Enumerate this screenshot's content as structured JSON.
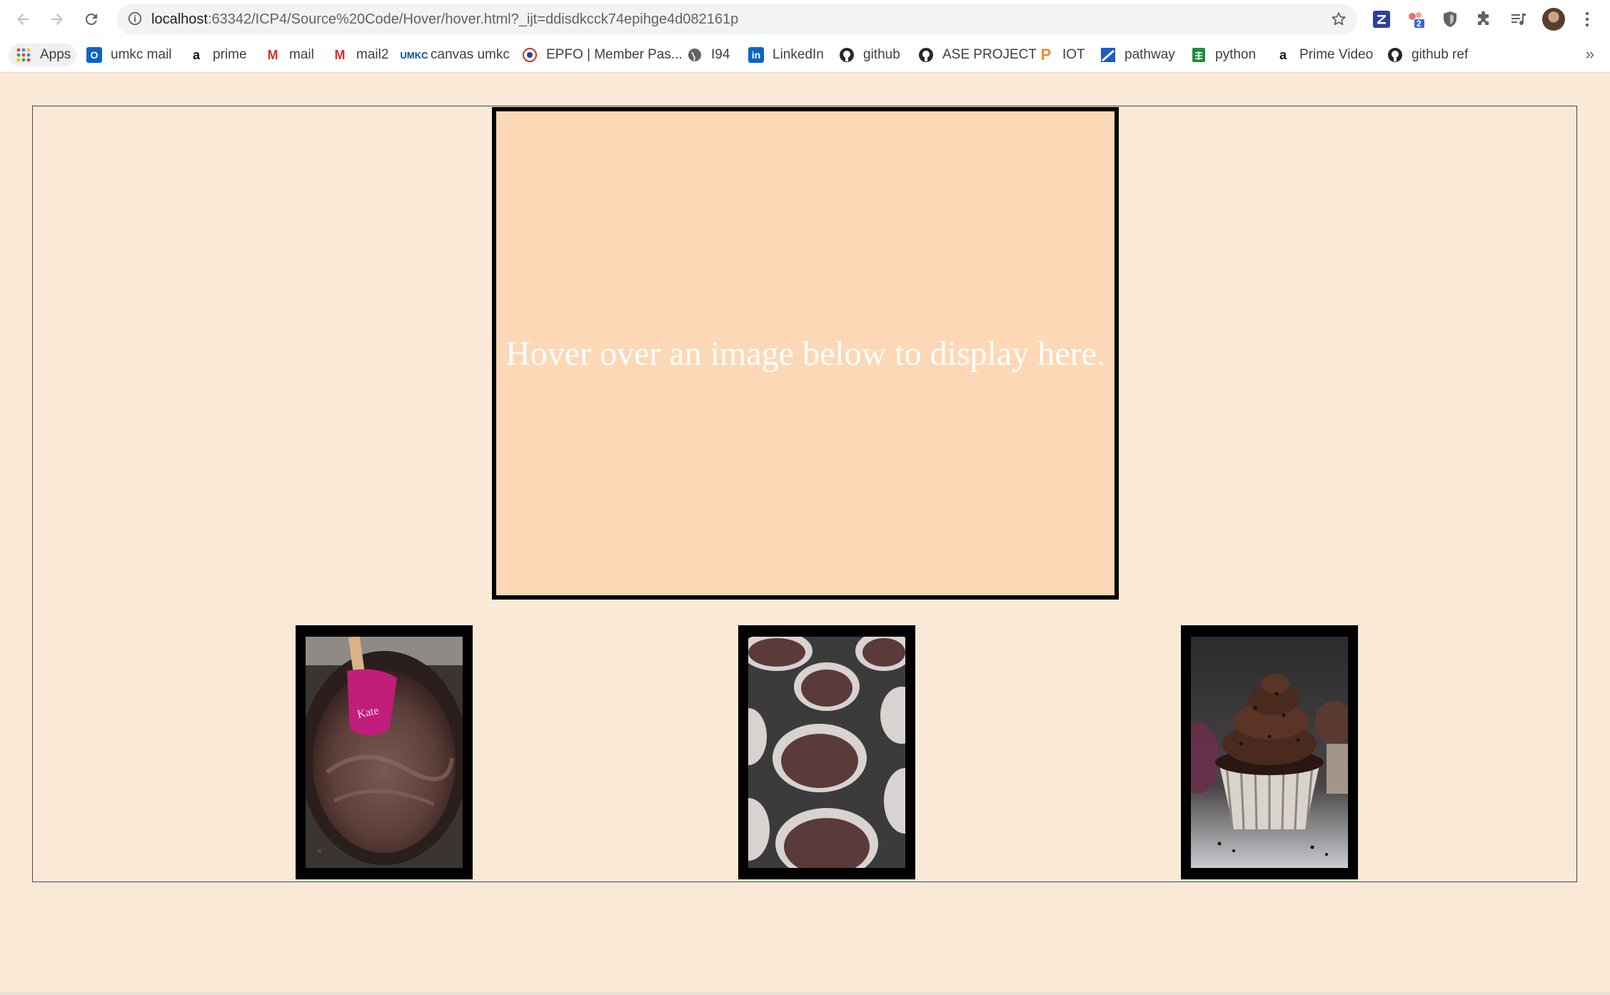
{
  "browser": {
    "url_host": "localhost",
    "url_rest": ":63342/ICP4/Source%20Code/Hover/hover.html?_ijt=ddisdkcck74epihge4d082161p",
    "extension_badge": "2"
  },
  "bookmarks": [
    {
      "label": "Apps",
      "icon": "apps-grid-icon"
    },
    {
      "label": "umkc mail",
      "icon": "outlook-icon",
      "color": "#0a64c8"
    },
    {
      "label": "prime",
      "icon": "amazon-icon"
    },
    {
      "label": "mail",
      "icon": "gmail-icon",
      "color": "#d93025"
    },
    {
      "label": "mail2",
      "icon": "gmail-icon",
      "color": "#d93025"
    },
    {
      "label": "canvas umkc",
      "icon": "umkc-icon",
      "color": "#0a4fa0"
    },
    {
      "label": "EPFO | Member Pas...",
      "icon": "epfo-icon",
      "color": "#c0392b"
    },
    {
      "label": "I94",
      "icon": "globe-icon"
    },
    {
      "label": "LinkedIn",
      "icon": "linkedin-icon",
      "color": "#0a66c2"
    },
    {
      "label": "github",
      "icon": "github-icon"
    },
    {
      "label": "ASE PROJECT",
      "icon": "github-icon"
    },
    {
      "label": "IOT",
      "icon": "p-icon",
      "color": "#f08a24"
    },
    {
      "label": "pathway",
      "icon": "pathway-icon",
      "color": "#1a5cc8"
    },
    {
      "label": "python",
      "icon": "sheets-icon",
      "color": "#1e8e3e"
    },
    {
      "label": "Prime Video",
      "icon": "amazon-icon"
    },
    {
      "label": "github ref",
      "icon": "github-icon"
    }
  ],
  "overflow": "»",
  "page": {
    "display_text": "Hover over an image below to display here.",
    "thumbnails": [
      {
        "name": "batter-bowl-image",
        "subject": "chocolate batter in bowl with pink spatula"
      },
      {
        "name": "cupcake-liners-image",
        "subject": "cupcake liners filled with batter in tin"
      },
      {
        "name": "frosted-cupcake-image",
        "subject": "chocolate frosted cupcake with sprinkles"
      }
    ]
  }
}
